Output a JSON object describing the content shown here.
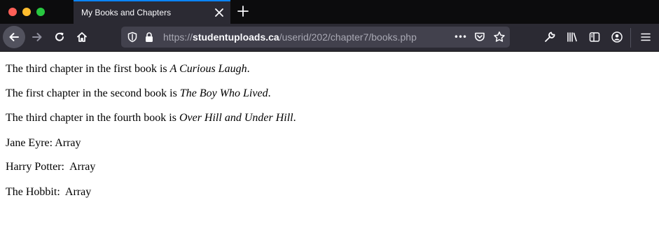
{
  "browser": {
    "tab_title": "My Books and Chapters",
    "url_scheme": "https://",
    "url_host": "studentuploads.ca",
    "url_path": "/userid/202/chapter7/books.php",
    "url_more": "•••",
    "accent_color": "#0a84ff",
    "icons": [
      "back-arrow-icon",
      "forward-arrow-icon",
      "reload-icon",
      "home-icon",
      "tracking-shield-icon",
      "lock-icon",
      "more-actions-icon",
      "pocket-icon",
      "bookmark-star-icon",
      "wrench-icon",
      "library-icon",
      "sidebar-icon",
      "account-icon",
      "hamburger-menu-icon"
    ]
  },
  "page": {
    "lines": [
      {
        "prefix": "The third chapter in the first book is ",
        "title": "A Curious Laugh",
        "suffix": "."
      },
      {
        "prefix": "The first chapter in the second book is ",
        "title": "The Boy Who Lived",
        "suffix": "."
      },
      {
        "prefix": "The third chapter in the fourth book is ",
        "title": "Over Hill and Under Hill",
        "suffix": "."
      }
    ],
    "arrays": [
      {
        "text": "Jane Eyre: Array"
      },
      {
        "text": "Harry Potter:  Array"
      },
      {
        "text": "The Hobbit:  Array"
      }
    ]
  }
}
